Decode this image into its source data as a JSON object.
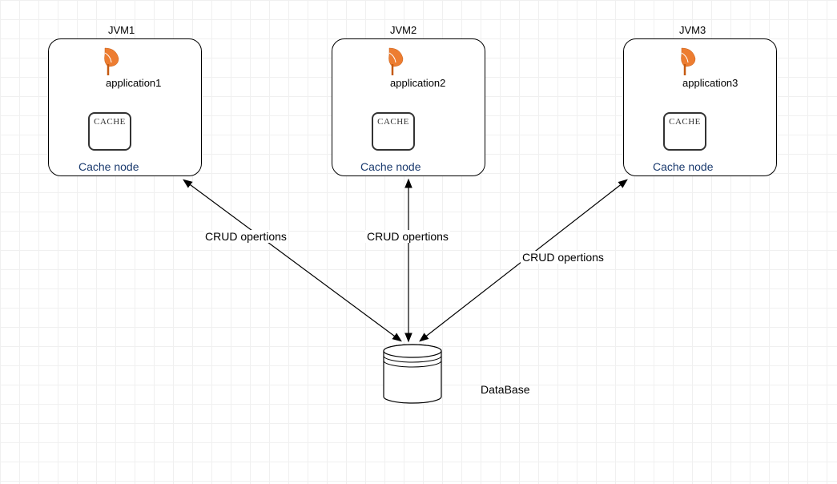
{
  "nodes": [
    {
      "title": "JVM1",
      "app": "application1",
      "cache": "CACHE",
      "cacheNode": "Cache node"
    },
    {
      "title": "JVM2",
      "app": "application2",
      "cache": "CACHE",
      "cacheNode": "Cache node"
    },
    {
      "title": "JVM3",
      "app": "application3",
      "cache": "CACHE",
      "cacheNode": "Cache node"
    }
  ],
  "edges": [
    {
      "label": "CRUD opertions"
    },
    {
      "label": "CRUD opertions"
    },
    {
      "label": "CRUD opertions"
    }
  ],
  "database": {
    "label": "DataBase"
  }
}
